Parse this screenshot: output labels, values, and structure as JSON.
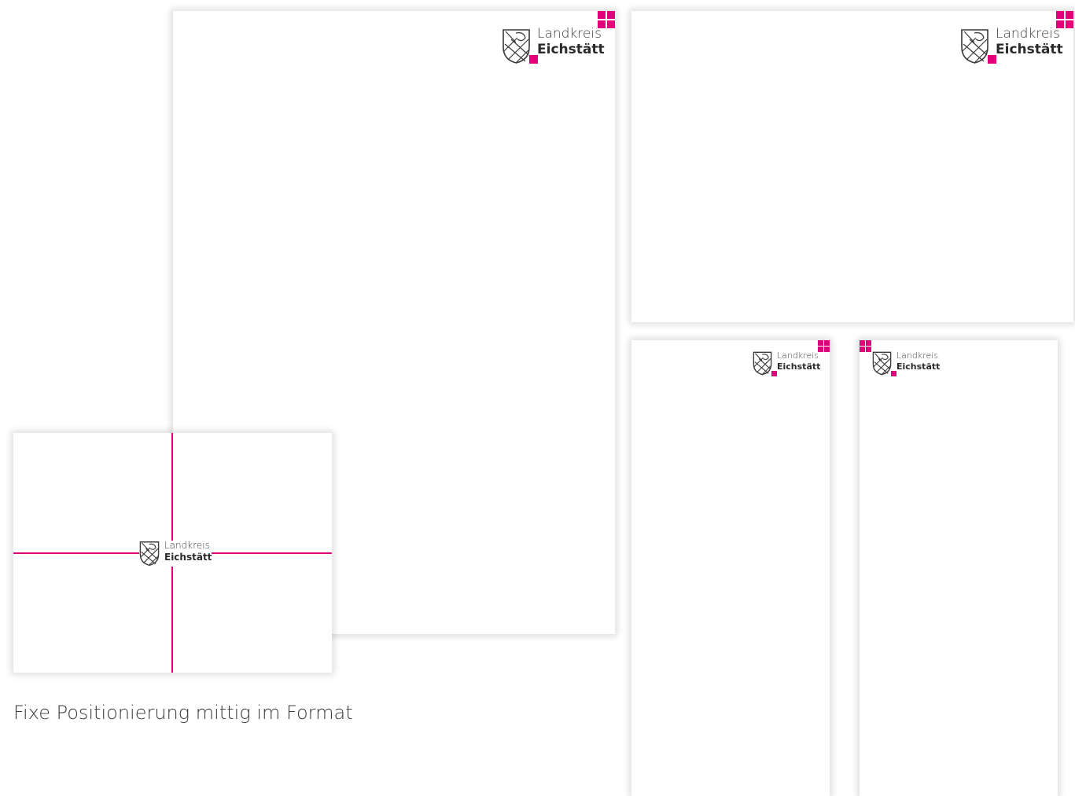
{
  "brand": {
    "line1": "Landkreis",
    "line2": "Eichstätt"
  },
  "caption": "Fixe Positionierung mittig im Format",
  "colors": {
    "accent": "#e2007a",
    "crest_stroke": "#3a3a3a",
    "shadow": "#dcdcdc"
  },
  "icons": {
    "crest": "coat-of-arms-icon",
    "squares": "magenta-squares-icon"
  }
}
